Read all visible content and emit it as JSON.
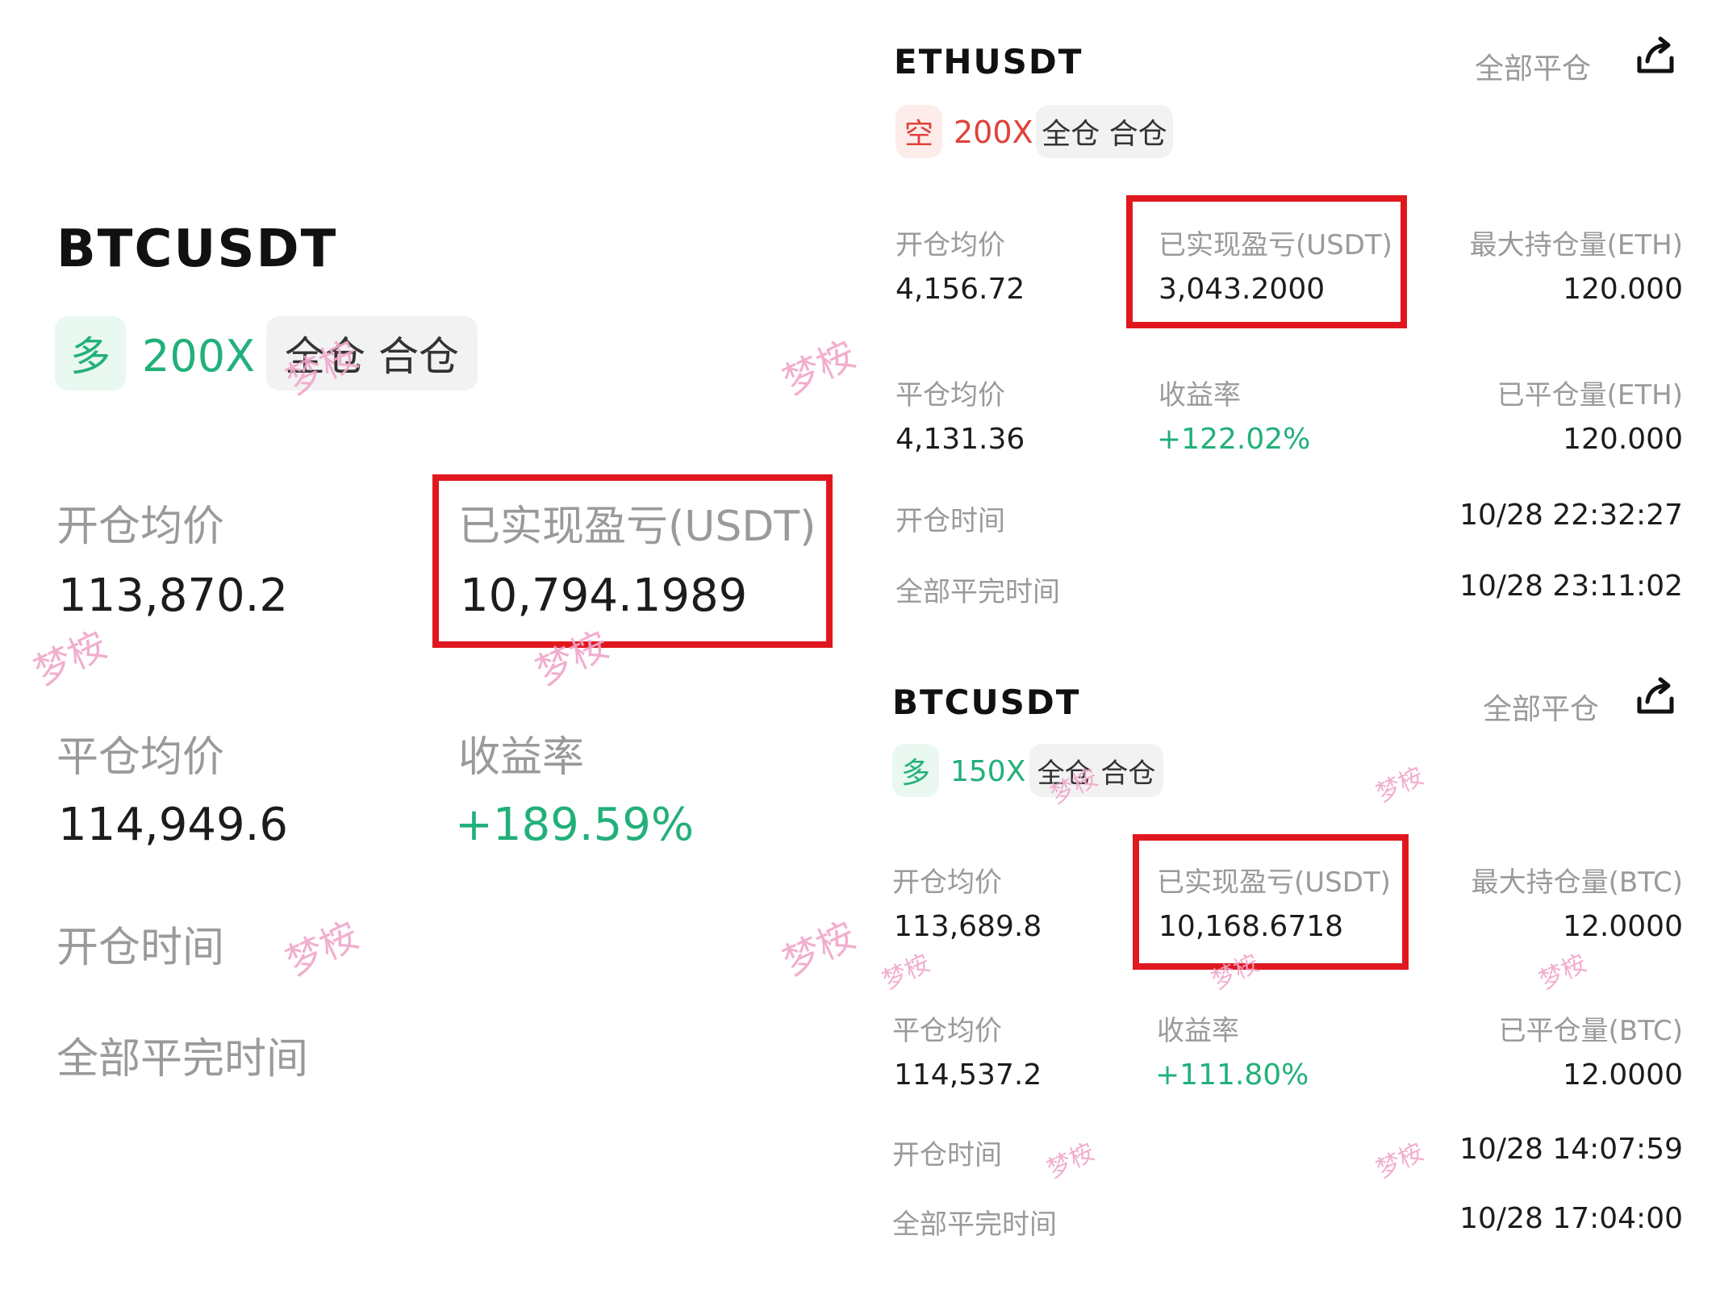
{
  "left": {
    "symbol": "BTCUSDT",
    "side": "多",
    "leverage": "200X",
    "margin_mode": "全仓 合仓",
    "open_avg_label": "开仓均价",
    "open_avg_value": "113,870.2",
    "realized_pnl_label": "已实现盈亏(USDT)",
    "realized_pnl_value": "10,794.1989",
    "close_avg_label": "平仓均价",
    "close_avg_value": "114,949.6",
    "roi_label": "收益率",
    "roi_value": "+189.59%",
    "open_time_label": "开仓时间",
    "close_time_label": "全部平完时间"
  },
  "eth": {
    "symbol": "ETHUSDT",
    "close_all": "全部平仓",
    "side": "空",
    "leverage": "200X",
    "margin_mode": "全仓 合仓",
    "open_avg_label": "开仓均价",
    "open_avg_value": "4,156.72",
    "realized_pnl_label": "已实现盈亏(USDT)",
    "realized_pnl_value": "3,043.2000",
    "max_pos_label": "最大持仓量(ETH)",
    "max_pos_value": "120.000",
    "close_avg_label": "平仓均价",
    "close_avg_value": "4,131.36",
    "roi_label": "收益率",
    "roi_value": "+122.02%",
    "closed_label": "已平仓量(ETH)",
    "closed_value": "120.000",
    "open_time_label": "开仓时间",
    "open_time_value": "10/28 22:32:27",
    "close_time_label": "全部平完时间",
    "close_time_value": "10/28 23:11:02"
  },
  "btc": {
    "symbol": "BTCUSDT",
    "close_all": "全部平仓",
    "side": "多",
    "leverage": "150X",
    "margin_mode": "全仓 合仓",
    "open_avg_label": "开仓均价",
    "open_avg_value": "113,689.8",
    "realized_pnl_label": "已实现盈亏(USDT)",
    "realized_pnl_value": "10,168.6718",
    "max_pos_label": "最大持仓量(BTC)",
    "max_pos_value": "12.0000",
    "close_avg_label": "平仓均价",
    "close_avg_value": "114,537.2",
    "roi_label": "收益率",
    "roi_value": "+111.80%",
    "closed_label": "已平仓量(BTC)",
    "closed_value": "12.0000",
    "open_time_label": "开仓时间",
    "open_time_value": "10/28 14:07:59",
    "close_time_label": "全部平完时间",
    "close_time_value": "10/28 17:04:00"
  },
  "watermark": "梦桉",
  "colors": {
    "long": "#22b07a",
    "short": "#e0413a",
    "highlight_box": "#e0171e",
    "watermark": "#f0a6c9"
  },
  "icons": {
    "share": "share-icon"
  }
}
